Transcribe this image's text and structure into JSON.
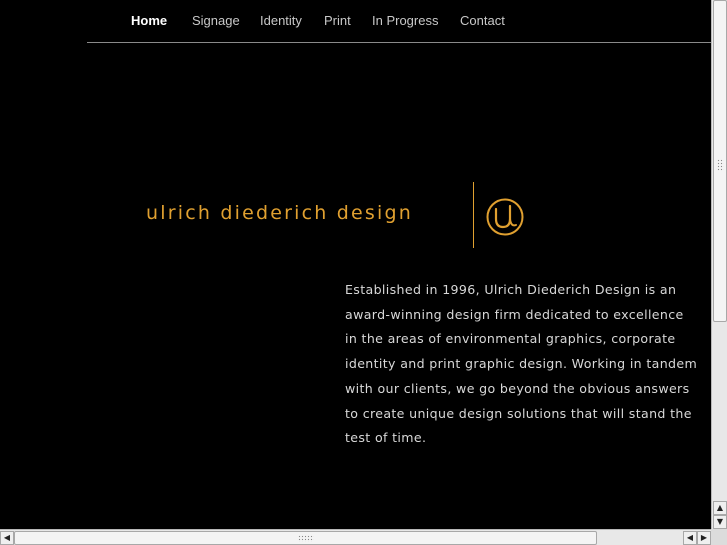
{
  "nav": {
    "items": [
      {
        "label": "Home",
        "active": true
      },
      {
        "label": "Signage",
        "active": false
      },
      {
        "label": "Identity",
        "active": false
      },
      {
        "label": "Print",
        "active": false
      },
      {
        "label": "In Progress",
        "active": false
      },
      {
        "label": "Contact",
        "active": false
      }
    ]
  },
  "logo": {
    "wordmark": "ulrich diederich design",
    "accent_color": "#e0a030"
  },
  "intro": {
    "text": "Established in 1996, Ulrich Diederich Design is an award-winning design firm dedicated to excellence in the areas of environmental graphics, corporate identity and print graphic design. Working in tandem with our clients, we go beyond the obvious answers to create unique design solutions that will stand the test of time."
  },
  "scrollbars": {
    "up_arrow": "▲",
    "down_arrow": "▼",
    "left_arrow": "◀",
    "right_arrow": "▶"
  }
}
